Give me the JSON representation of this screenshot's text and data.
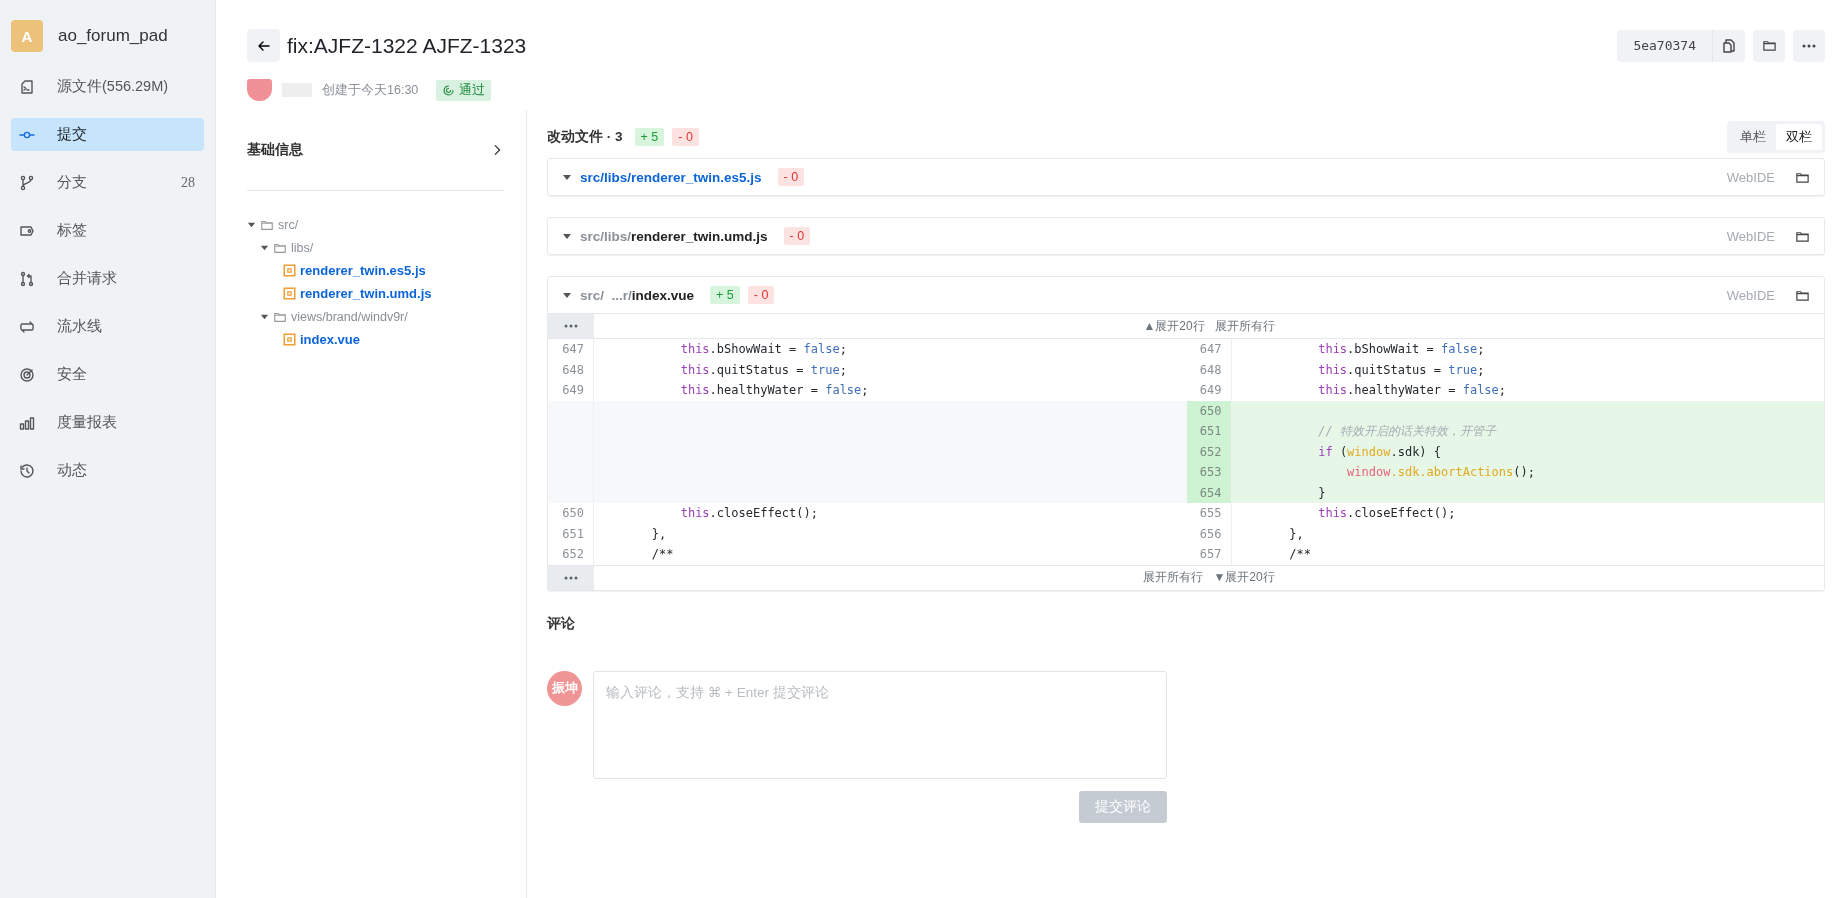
{
  "sidebar": {
    "repo": {
      "initial": "A",
      "name": "ao_forum_pad"
    },
    "items": [
      {
        "label": "源文件(556.29M)",
        "selected": false
      },
      {
        "label": "提交",
        "selected": true
      },
      {
        "label": "分支",
        "count": "28",
        "selected": false
      },
      {
        "label": "标签",
        "selected": false
      },
      {
        "label": "合并请求",
        "selected": false
      },
      {
        "label": "流水线",
        "selected": false
      },
      {
        "label": "安全",
        "selected": false
      },
      {
        "label": "度量报表",
        "selected": false
      },
      {
        "label": "动态",
        "selected": false
      }
    ]
  },
  "header": {
    "title": "fix:AJFZ-1322 AJFZ-1323",
    "created": "创建于今天16:30",
    "status": {
      "label": "通过",
      "kind": "passed"
    },
    "commit_hash": "5ea70374"
  },
  "basic_info": {
    "title": "基础信息"
  },
  "file_tree": [
    {
      "kind": "folder",
      "name": "src/",
      "expanded": true,
      "children": [
        {
          "kind": "folder",
          "name": "libs/",
          "expanded": true,
          "children": [
            {
              "kind": "file",
              "name": "renderer_twin.es5.js"
            },
            {
              "kind": "file",
              "name": "renderer_twin.umd.js"
            }
          ]
        },
        {
          "kind": "folder",
          "name": "views/brand/windv9r/",
          "expanded": true,
          "children": [
            {
              "kind": "file",
              "name": "index.vue"
            }
          ]
        }
      ]
    }
  ],
  "changes": {
    "title": "改动文件 · 3",
    "added": "+ 5",
    "removed": "- 0",
    "view_modes": [
      {
        "label": "单栏",
        "selected": false
      },
      {
        "label": "双栏",
        "selected": true
      }
    ],
    "files": [
      {
        "dir": "src/libs/",
        "name": "renderer_twin.es5.js",
        "selected": true,
        "removed": "- 0",
        "webide": "WebIDE"
      },
      {
        "dir": "src/libs/",
        "name": "renderer_twin.umd.js",
        "selected": false,
        "removed": "- 0",
        "webide": "WebIDE"
      },
      {
        "dir": "src/  ...r/",
        "name": "index.vue",
        "selected": false,
        "added": "+ 5",
        "removed": "- 0",
        "webide": "WebIDE",
        "diff": {
          "expand_top": [
            "▲展开20行",
            "展开所有行"
          ],
          "expand_bottom": [
            "展开所有行",
            "▼展开20行"
          ],
          "rows": [
            {
              "kind": "context",
              "left": {
                "num": "647",
                "tokens": [
                  {
                    "kind": "keyword",
                    "t": "            this"
                  },
                  {
                    "kind": "plain",
                    "t": ".bShowWait = "
                  },
                  {
                    "kind": "literal",
                    "t": "false"
                  },
                  {
                    "kind": "plain",
                    "t": ";"
                  }
                ]
              },
              "right": {
                "num": "647",
                "tokens": [
                  {
                    "kind": "keyword",
                    "t": "            this"
                  },
                  {
                    "kind": "plain",
                    "t": ".bShowWait = "
                  },
                  {
                    "kind": "literal",
                    "t": "false"
                  },
                  {
                    "kind": "plain",
                    "t": ";"
                  }
                ]
              }
            },
            {
              "kind": "context",
              "left": {
                "num": "648",
                "tokens": [
                  {
                    "kind": "keyword",
                    "t": "            this"
                  },
                  {
                    "kind": "plain",
                    "t": ".quitStatus = "
                  },
                  {
                    "kind": "literal",
                    "t": "true"
                  },
                  {
                    "kind": "plain",
                    "t": ";"
                  }
                ]
              },
              "right": {
                "num": "648",
                "tokens": [
                  {
                    "kind": "keyword",
                    "t": "            this"
                  },
                  {
                    "kind": "plain",
                    "t": ".quitStatus = "
                  },
                  {
                    "kind": "literal",
                    "t": "true"
                  },
                  {
                    "kind": "plain",
                    "t": ";"
                  }
                ]
              }
            },
            {
              "kind": "context",
              "left": {
                "num": "649",
                "tokens": [
                  {
                    "kind": "keyword",
                    "t": "            this"
                  },
                  {
                    "kind": "plain",
                    "t": ".healthyWater = "
                  },
                  {
                    "kind": "literal",
                    "t": "false"
                  },
                  {
                    "kind": "plain",
                    "t": ";"
                  }
                ]
              },
              "right": {
                "num": "649",
                "tokens": [
                  {
                    "kind": "keyword",
                    "t": "            this"
                  },
                  {
                    "kind": "plain",
                    "t": ".healthyWater = "
                  },
                  {
                    "kind": "literal",
                    "t": "false"
                  },
                  {
                    "kind": "plain",
                    "t": ";"
                  }
                ]
              }
            },
            {
              "kind": "added",
              "right": {
                "num": "650"
              }
            },
            {
              "kind": "added",
              "right": {
                "num": "651",
                "tokens": [
                  {
                    "kind": "comment",
                    "t": "            // 特效开启的话关特效，开管子"
                  }
                ]
              }
            },
            {
              "kind": "added",
              "right": {
                "num": "652",
                "tokens": [
                  {
                    "kind": "keyword",
                    "t": "            if"
                  },
                  {
                    "kind": "plain",
                    "t": " ("
                  },
                  {
                    "kind": "global",
                    "t": "window"
                  },
                  {
                    "kind": "plain",
                    "t": ".sdk) {"
                  }
                ]
              }
            },
            {
              "kind": "added",
              "right": {
                "num": "653",
                "tokens": [
                  {
                    "kind": "object",
                    "t": "                window"
                  },
                  {
                    "kind": "global",
                    "t": ".sdk.abortActions"
                  },
                  {
                    "kind": "plain",
                    "t": "();"
                  }
                ]
              }
            },
            {
              "kind": "added",
              "right": {
                "num": "654",
                "tokens": [
                  {
                    "kind": "plain",
                    "t": "            }"
                  }
                ]
              }
            },
            {
              "kind": "context",
              "left": {
                "num": "650",
                "tokens": [
                  {
                    "kind": "keyword",
                    "t": "            this"
                  },
                  {
                    "kind": "plain",
                    "t": ".closeEffect();"
                  }
                ]
              },
              "right": {
                "num": "655",
                "tokens": [
                  {
                    "kind": "keyword",
                    "t": "            this"
                  },
                  {
                    "kind": "plain",
                    "t": ".closeEffect();"
                  }
                ]
              }
            },
            {
              "kind": "context",
              "left": {
                "num": "651",
                "tokens": [
                  {
                    "kind": "plain",
                    "t": "        },"
                  }
                ]
              },
              "right": {
                "num": "656",
                "tokens": [
                  {
                    "kind": "plain",
                    "t": "        },"
                  }
                ]
              }
            },
            {
              "kind": "context",
              "left": {
                "num": "652",
                "tokens": [
                  {
                    "kind": "plain",
                    "t": "        /**"
                  }
                ]
              },
              "right": {
                "num": "657",
                "tokens": [
                  {
                    "kind": "plain",
                    "t": "        /**"
                  }
                ]
              }
            }
          ]
        }
      }
    ]
  },
  "comments": {
    "title": "评论",
    "avatar": "振坤",
    "placeholder": "输入评论，支持 ⌘ + Enter 提交评论",
    "submit": {
      "label": "提交评论",
      "disabled": true
    }
  }
}
